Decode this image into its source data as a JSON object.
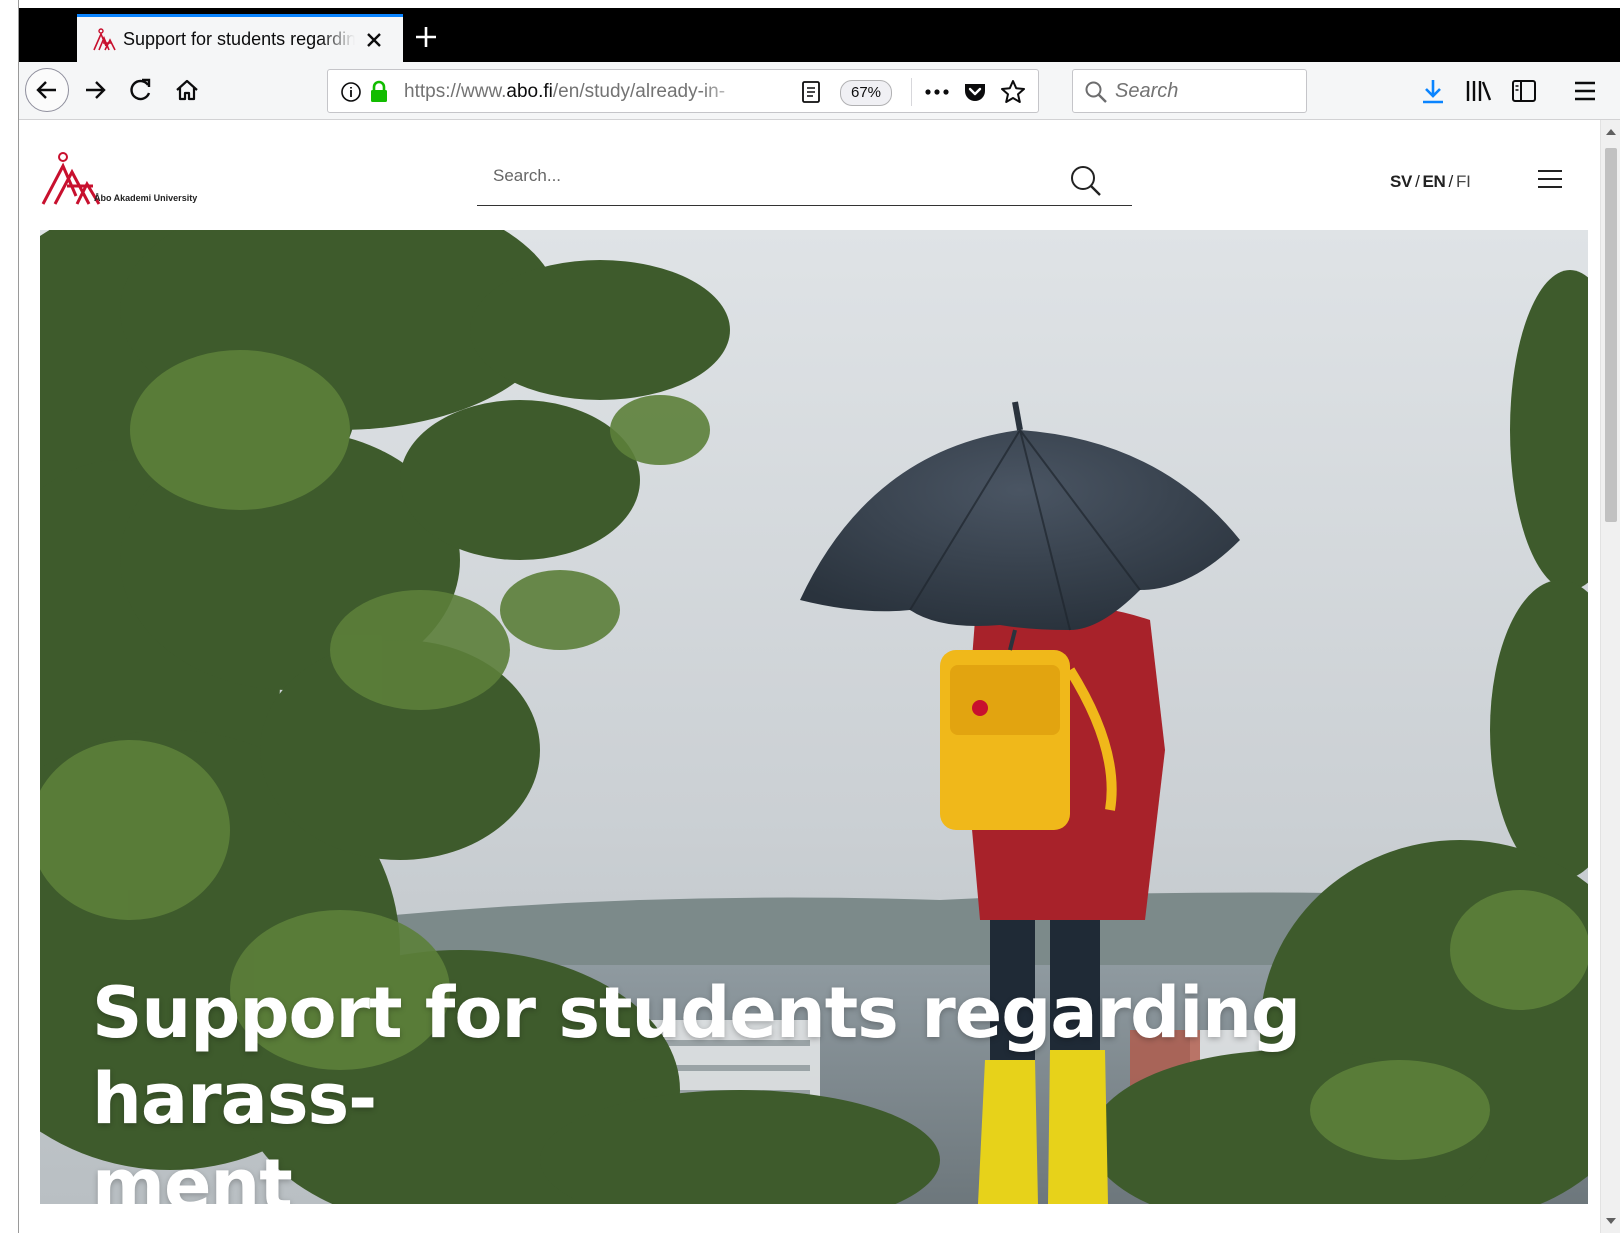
{
  "browser": {
    "tab": {
      "title": "Support for students regarding harassment",
      "favicon": "abo-akademi-favicon-icon"
    },
    "new_tab_icon": "plus-icon",
    "url": {
      "scheme": "https://www.",
      "host": "abo.fi",
      "path": "/en/study/already-in-"
    },
    "zoom": "67%",
    "search": {
      "placeholder": "Search"
    },
    "icons": [
      "back-icon",
      "forward-icon",
      "reload-icon",
      "home-icon",
      "info-icon",
      "lock-icon",
      "reader-view-icon",
      "more-icon",
      "pocket-icon",
      "bookmark-star-icon",
      "download-icon",
      "library-icon",
      "sidebar-icon",
      "menu-icon"
    ],
    "colors": {
      "tab_accent": "#0a84ff",
      "lock": "#12bc00",
      "download": "#0a84ff"
    }
  },
  "site": {
    "logo_text": "Åbo Akademi University",
    "search_placeholder": "Search...",
    "languages": [
      "SV",
      "EN",
      "FI"
    ],
    "hero": {
      "title_line1": "Support for students regarding harass-",
      "title_line2": "ment"
    },
    "colors": {
      "brand_red": "#c8102e"
    }
  }
}
